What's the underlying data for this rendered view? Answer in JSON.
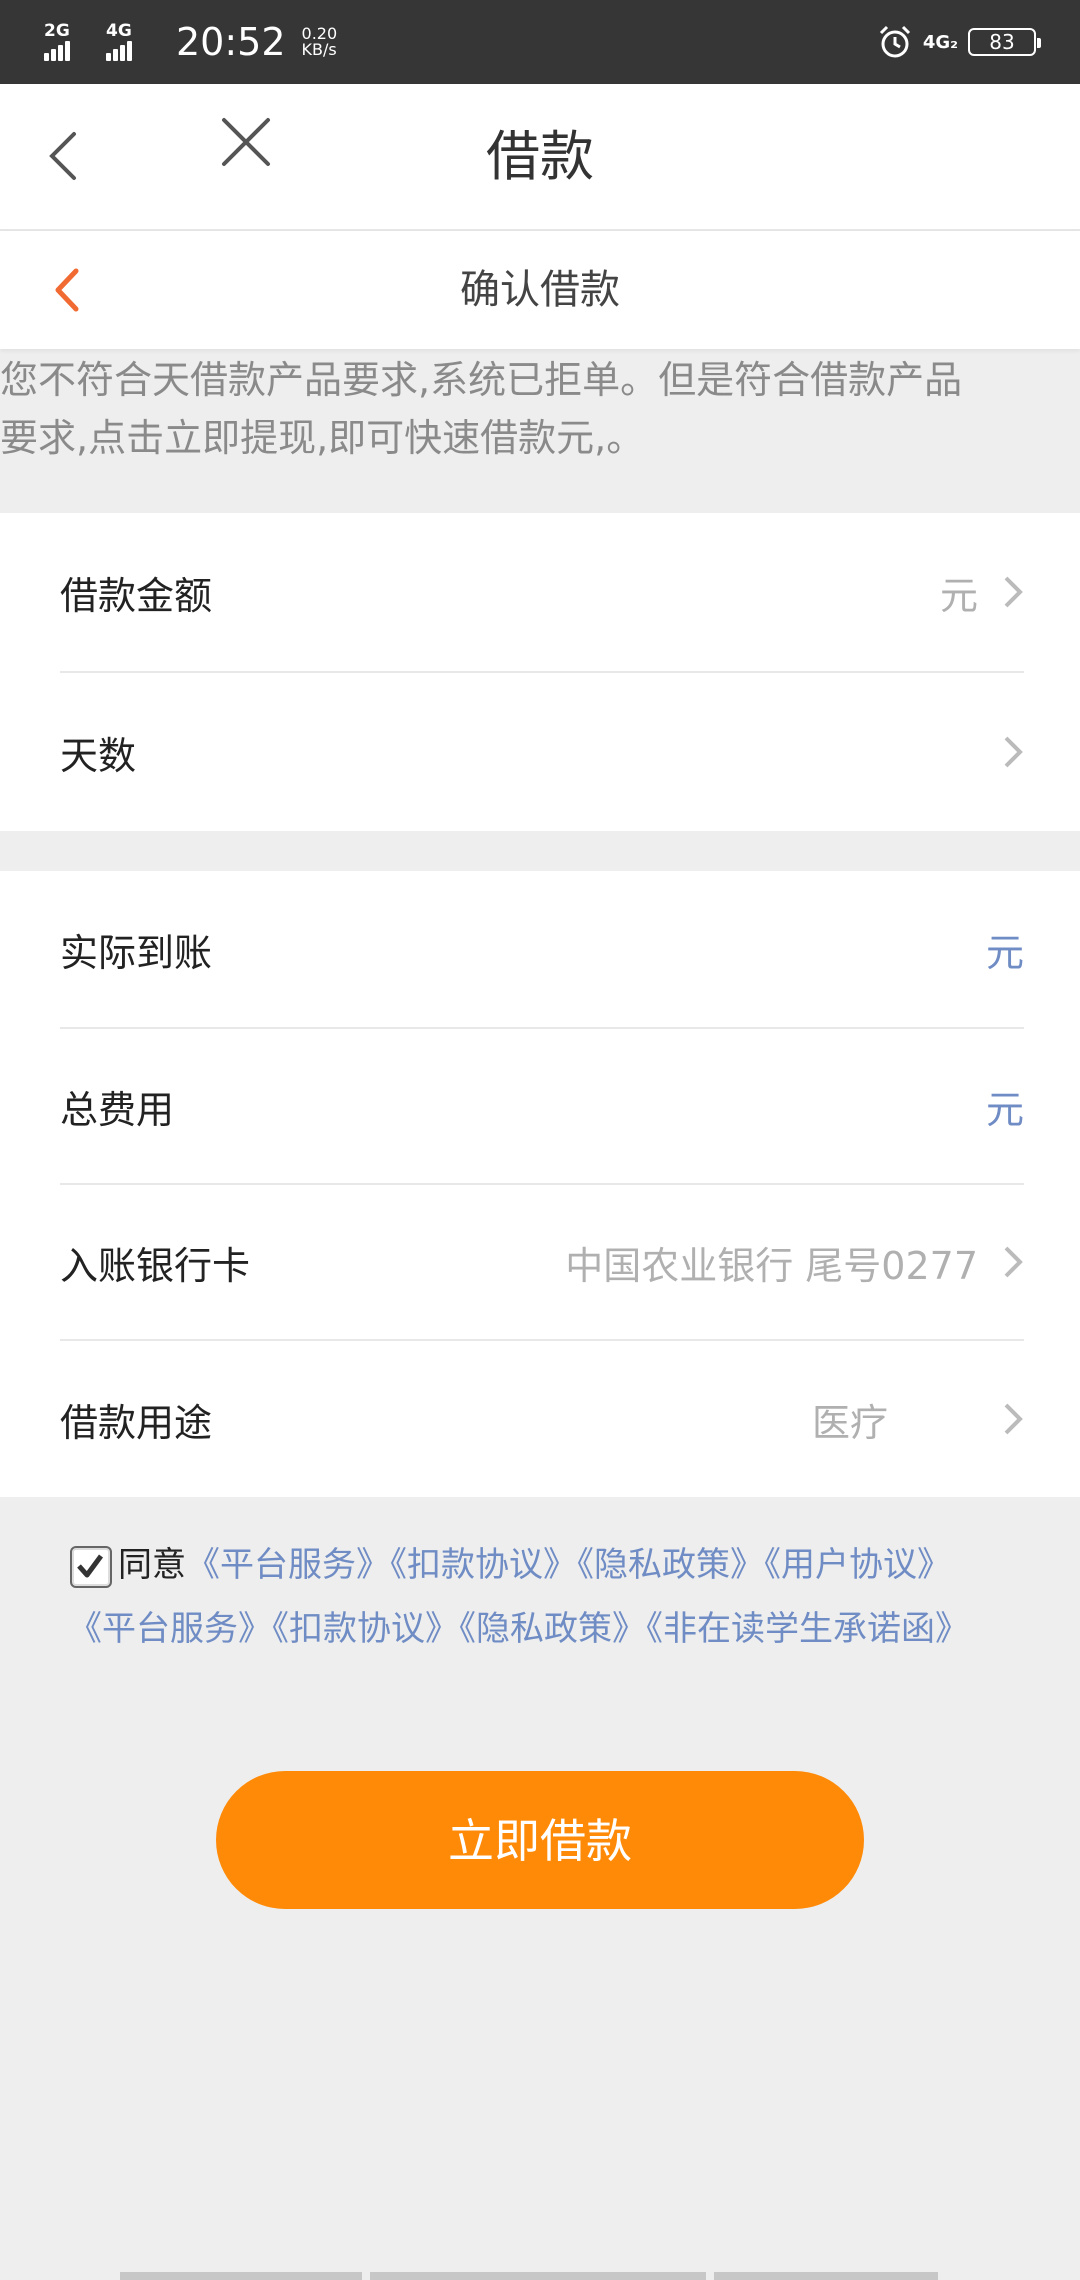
{
  "status_bar": {
    "sim1": "2G",
    "sim2": "4G",
    "time": "20:52",
    "speed_value": "0.20",
    "speed_unit": "KB/s",
    "net_type": "4G₂",
    "battery": "83"
  },
  "top_nav": {
    "title": "借款"
  },
  "sub_header": {
    "title": "确认借款"
  },
  "notice": {
    "line1": "您不符合天借款产品要求,系统已拒单。但是符合借款产品",
    "line2": "要求,点击立即提现,即可快速借款元,。"
  },
  "group1": [
    {
      "label": "借款金额",
      "value": "元",
      "value_style": "gray",
      "chevron": true
    },
    {
      "label": "天数",
      "value": "",
      "value_style": "gray",
      "chevron": true
    }
  ],
  "group2": [
    {
      "label": "实际到账",
      "value": "元",
      "value_style": "blue",
      "chevron": false
    },
    {
      "label": "总费用",
      "value": "元",
      "value_style": "blue",
      "chevron": false
    },
    {
      "label": "入账银行卡",
      "value": "中国农业银行 尾号0277",
      "value_style": "gray",
      "chevron": true
    },
    {
      "label": "借款用途",
      "value": "医疗",
      "value_style": "gray",
      "chevron": true
    }
  ],
  "agreement": {
    "checked": true,
    "agree_text": "同意",
    "links_line1": [
      "《平台服务》",
      "《扣款协议》",
      "《隐私政策》",
      "《用户协议》"
    ],
    "links_line2": [
      "《平台服务》",
      "《扣款协议》",
      "《隐私政策》",
      "《非在读学生承诺函》"
    ]
  },
  "submit": {
    "label": "立即借款"
  },
  "colors": {
    "accent": "#ff8a08",
    "link": "#6f8cc4",
    "back_arrow": "#f06a32"
  }
}
